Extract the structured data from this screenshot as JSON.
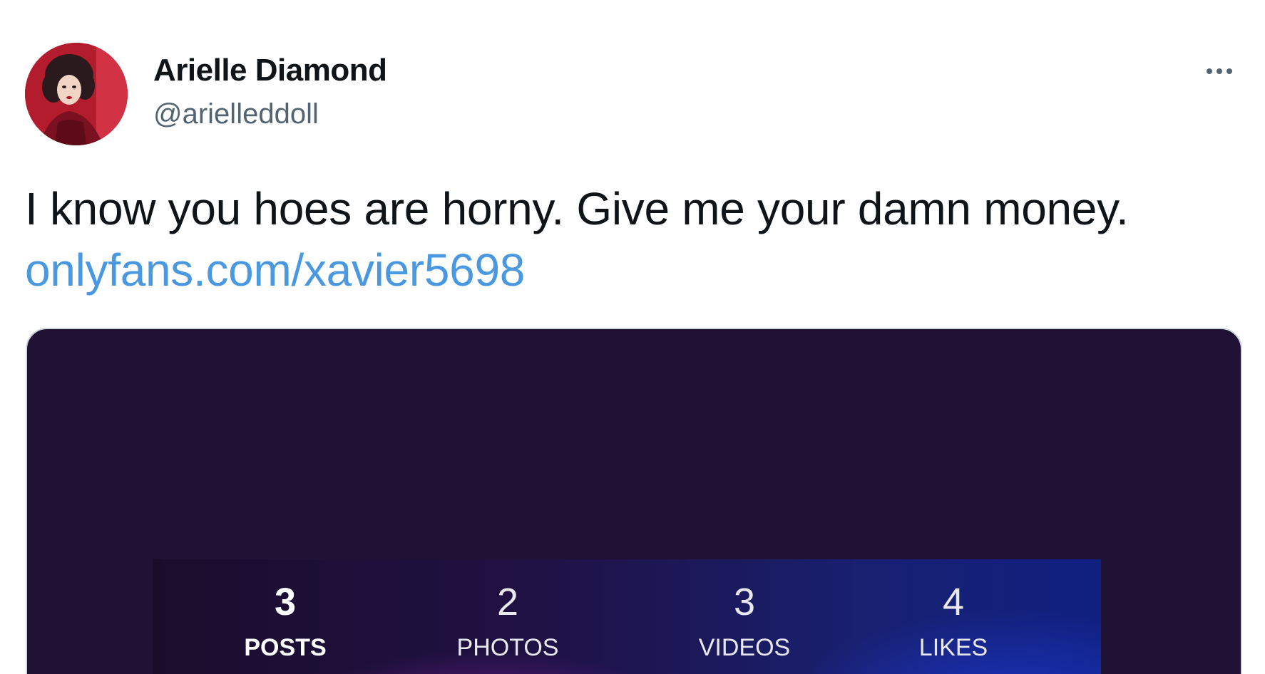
{
  "author": {
    "name": "Arielle Diamond",
    "handle": "@arielleddoll"
  },
  "tweet": {
    "text": "I know you hoes are horny. Give me your damn money.",
    "link": "onlyfans.com/xavier5698"
  },
  "more_icon": "more-horizontal-icon",
  "media": {
    "stats": [
      {
        "value": "3",
        "label": "POSTS",
        "active": true
      },
      {
        "value": "2",
        "label": "PHOTOS",
        "active": false
      },
      {
        "value": "3",
        "label": "VIDEOS",
        "active": false
      },
      {
        "value": "4",
        "label": "LIKES",
        "active": false
      }
    ]
  },
  "colors": {
    "link": "#4a98e0",
    "text": "#0f1419",
    "secondary": "#536471",
    "card_background": "#1f1235"
  }
}
